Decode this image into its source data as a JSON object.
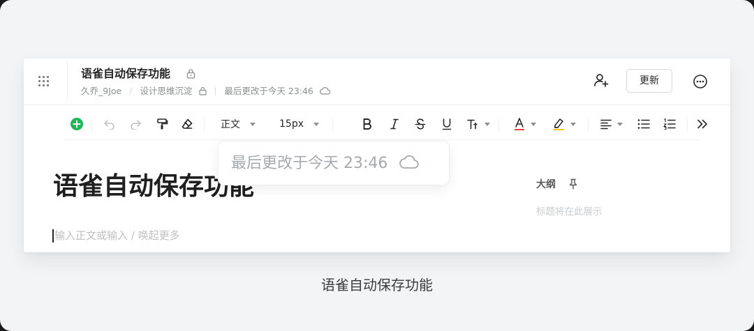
{
  "header": {
    "doc_title": "语雀自动保存功能",
    "author": "久乔_9Joe",
    "separator": "/",
    "knowledge_base": "设计思维沉淀",
    "last_modified": "最后更改于今天 23:46",
    "update_button": "更新"
  },
  "toolbar": {
    "paragraph_style": "正文",
    "font_size": "15px"
  },
  "popover": {
    "text": "最后更改于今天 23:46"
  },
  "editor": {
    "title": "语雀自动保存功能",
    "placeholder": "输入正文或输入 / 唤起更多"
  },
  "outline": {
    "title": "大纲",
    "empty_text": "标题将在此展示"
  },
  "caption": "语雀自动保存功能",
  "colors": {
    "accent_green": "#1fb65a",
    "font_color_underline": "#e8403c",
    "highlight_underline": "#f5c518"
  }
}
